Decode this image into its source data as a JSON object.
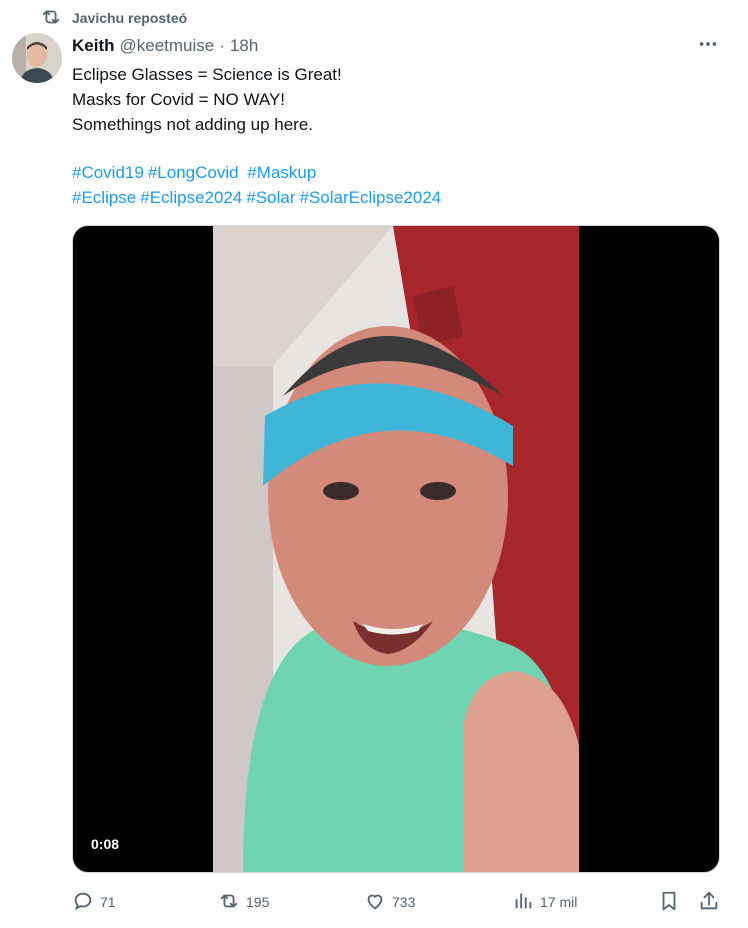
{
  "repost": {
    "label": "Javichu reposteó",
    "icon": "repost-icon"
  },
  "author": {
    "display_name": "Keith",
    "handle": "@keetmuise",
    "separator": "·",
    "time": "18h",
    "avatar_icon": "avatar"
  },
  "post": {
    "lines": [
      "Eclipse Glasses = Science is Great!",
      "Masks for Covid = NO WAY!",
      "Somethings not adding up here."
    ],
    "hashtag_lines": [
      [
        "#Covid19",
        "#LongCovid",
        " #Maskup"
      ],
      [
        "#Eclipse",
        "#Eclipse2024",
        "#Solar",
        "#SolarEclipse2024"
      ]
    ]
  },
  "media": {
    "duration": "0:08"
  },
  "actions": {
    "replies": "71",
    "reposts": "195",
    "likes": "733",
    "views": "17 mil"
  },
  "colors": {
    "accent": "#1d9bf0",
    "secondary_text": "#536471",
    "primary_text": "#0f1419"
  }
}
